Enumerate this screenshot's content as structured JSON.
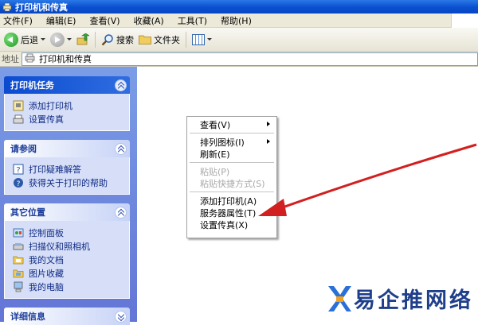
{
  "window": {
    "title": "打印机和传真"
  },
  "menubar": {
    "items": [
      "文件(F)",
      "编辑(E)",
      "查看(V)",
      "收藏(A)",
      "工具(T)",
      "帮助(H)"
    ]
  },
  "toolbar": {
    "back_label": "后退",
    "search_label": "搜索",
    "folders_label": "文件夹"
  },
  "addressbar": {
    "label": "地址",
    "value": "打印机和传真"
  },
  "taskpane": {
    "panels": [
      {
        "title": "打印机任务",
        "items": [
          "添加打印机",
          "设置传真"
        ]
      },
      {
        "title": "请参阅",
        "items": [
          "打印疑难解答",
          "获得关于打印的帮助"
        ]
      },
      {
        "title": "其它位置",
        "items": [
          "控制面板",
          "扫描仪和照相机",
          "我的文档",
          "图片收藏",
          "我的电脑"
        ]
      },
      {
        "title": "详细信息"
      }
    ]
  },
  "contextmenu": {
    "items": [
      "查看(V)",
      "排列图标(I)",
      "刷新(E)",
      "粘贴(P)",
      "粘贴快捷方式(S)",
      "添加打印机(A)",
      "服务器属性(T)",
      "设置传真(X)"
    ]
  },
  "watermark": {
    "text": "易企推网络"
  },
  "colors": {
    "arrow": "#d21f1f",
    "accent": "#0b4bd0"
  },
  "icons": {
    "titlebar": "printer-folder-icon",
    "toolbar": [
      "back-icon",
      "forward-icon",
      "up-folder-icon",
      "search-icon",
      "folders-icon",
      "view-icon"
    ]
  }
}
